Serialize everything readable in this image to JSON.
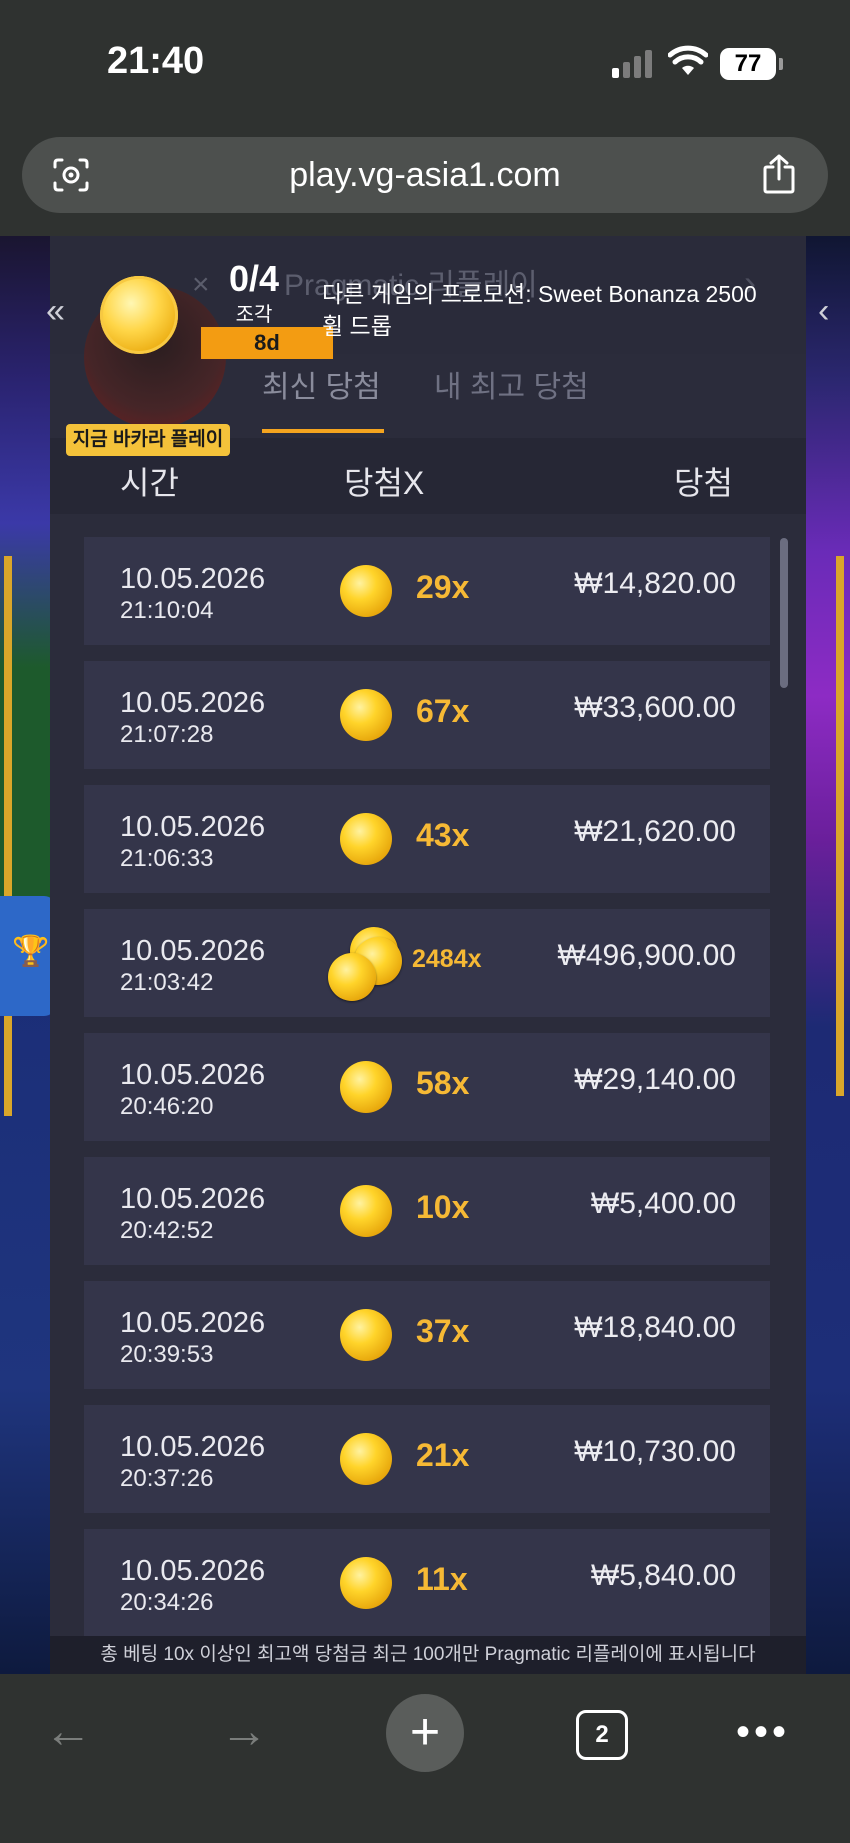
{
  "status": {
    "time": "21:40",
    "battery": "77"
  },
  "browser": {
    "url": "play.vg-asia1.com",
    "tab_count": "2"
  },
  "header": {
    "faded_title": "Pragmatic 리플레이",
    "tabs": [
      {
        "label": "최신 당첨",
        "active": true
      },
      {
        "label": "내 최고 당첨",
        "active": false
      }
    ]
  },
  "promo": {
    "count": "0/4",
    "count_label": "조각",
    "days": "8d",
    "text": "다른 게임의 프로모션: Sweet Bonanza 2500 휠 드롭",
    "play_now": "지금 바카라 플레이"
  },
  "table": {
    "columns": [
      "시간",
      "당첨X",
      "당첨"
    ],
    "rows": [
      {
        "date": "10.05.2026",
        "time": "21:10:04",
        "multiplier": "29x",
        "amount": "₩14,820.00",
        "coin": "single"
      },
      {
        "date": "10.05.2026",
        "time": "21:07:28",
        "multiplier": "67x",
        "amount": "₩33,600.00",
        "coin": "single"
      },
      {
        "date": "10.05.2026",
        "time": "21:06:33",
        "multiplier": "43x",
        "amount": "₩21,620.00",
        "coin": "single"
      },
      {
        "date": "10.05.2026",
        "time": "21:03:42",
        "multiplier": "2484x",
        "amount": "₩496,900.00",
        "coin": "stack"
      },
      {
        "date": "10.05.2026",
        "time": "20:46:20",
        "multiplier": "58x",
        "amount": "₩29,140.00",
        "coin": "single"
      },
      {
        "date": "10.05.2026",
        "time": "20:42:52",
        "multiplier": "10x",
        "amount": "₩5,400.00",
        "coin": "single"
      },
      {
        "date": "10.05.2026",
        "time": "20:39:53",
        "multiplier": "37x",
        "amount": "₩18,840.00",
        "coin": "single"
      },
      {
        "date": "10.05.2026",
        "time": "20:37:26",
        "multiplier": "21x",
        "amount": "₩10,730.00",
        "coin": "single"
      },
      {
        "date": "10.05.2026",
        "time": "20:34:26",
        "multiplier": "11x",
        "amount": "₩5,840.00",
        "coin": "single"
      }
    ]
  },
  "footer_note": "총 베팅 10x 이상인 최고액 당첨금 최근 100개만 Pragmatic 리플레이에 표시됩니다",
  "colors": {
    "accent": "#f4a41f",
    "multiplier": "#f6b935",
    "panel": "#2b2c3b",
    "row": "#34354a"
  }
}
